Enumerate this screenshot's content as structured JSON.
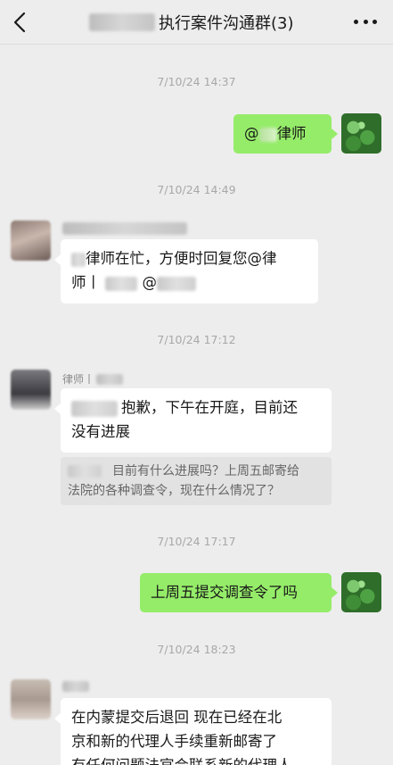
{
  "header": {
    "title": "执行案件沟通群(3)",
    "back_icon": "chevron-left-icon",
    "more_icon": "more-dots-icon"
  },
  "messages": {
    "m1": {
      "time": "7/10/24 14:37",
      "text_prefix": "@",
      "text_suffix": "律师"
    },
    "m2": {
      "time": "7/10/24 14:49",
      "line1": "律师在忙，方便时回复您@律",
      "line2_start": "师丨",
      "line2_at": "@"
    },
    "m3": {
      "time": "7/10/24 17:12",
      "sender_label": "律师丨",
      "line1": "抱歉，下午在开庭，目前还",
      "line2": "没有进展",
      "quote_line1": "目前有什么进展吗？上周五邮寄给",
      "quote_line2": "法院的各种调查令，现在什么情况了？"
    },
    "m4": {
      "time": "7/10/24 17:17",
      "text": "上周五提交调查令了吗"
    },
    "m5": {
      "time": "7/10/24 18:23",
      "line1": "在内蒙提交后退回  现在已经在北",
      "line2": "京和新的代理人手续重新邮寄了",
      "line3": "有任何问题法官会联系新的代理人"
    }
  },
  "colors": {
    "background": "#ededed",
    "outgoing_bubble": "#95ec69",
    "incoming_bubble": "#ffffff",
    "timestamp": "#a8a8a8"
  }
}
